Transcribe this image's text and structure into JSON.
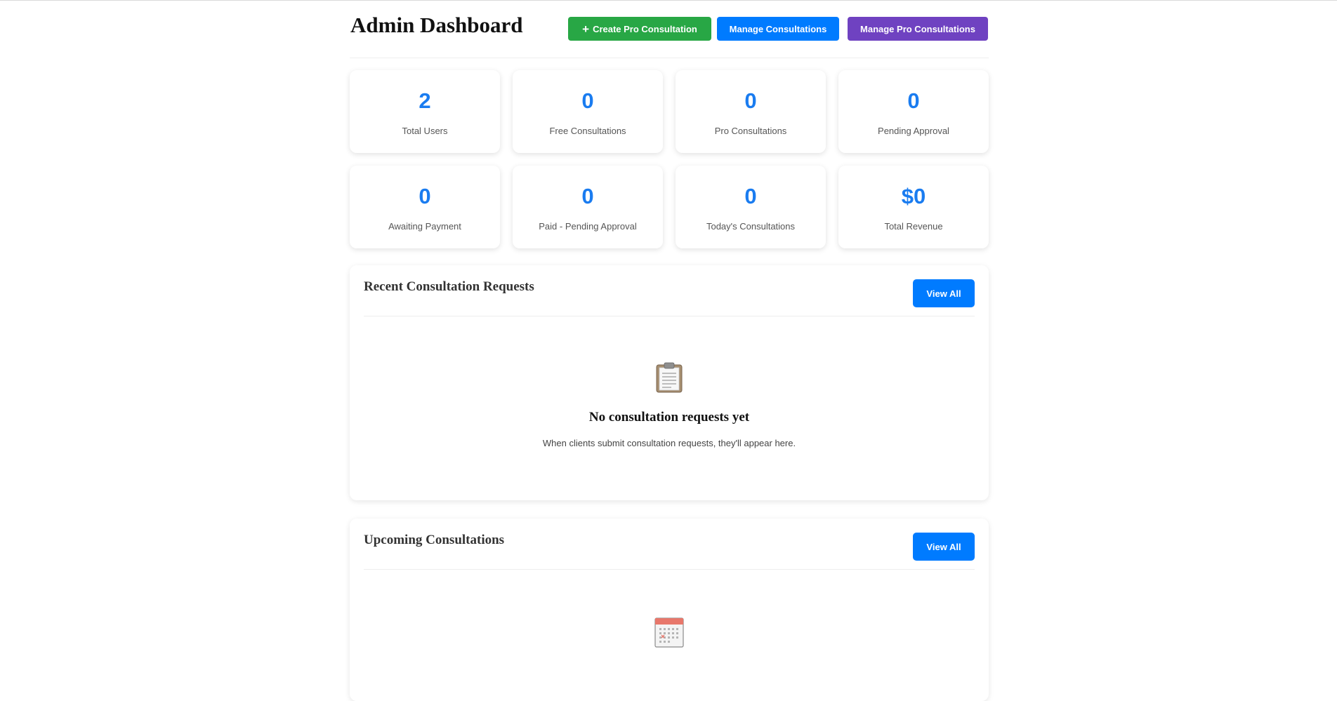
{
  "header": {
    "title": "Admin Dashboard",
    "buttons": {
      "create_pro": "Create Pro Consultation",
      "create_pro_icon": "+",
      "manage": "Manage Consultations",
      "manage_pro": "Manage Pro Consultations"
    }
  },
  "stats": [
    {
      "value": "2",
      "label": "Total Users"
    },
    {
      "value": "0",
      "label": "Free Consultations"
    },
    {
      "value": "0",
      "label": "Pro Consultations"
    },
    {
      "value": "0",
      "label": "Pending Approval"
    },
    {
      "value": "0",
      "label": "Awaiting Payment"
    },
    {
      "value": "0",
      "label": "Paid - Pending Approval"
    },
    {
      "value": "0",
      "label": "Today's Consultations"
    },
    {
      "value": "$0",
      "label": "Total Revenue"
    }
  ],
  "recent": {
    "title": "Recent Consultation Requests",
    "view_all": "View All",
    "empty_icon": "clipboard-icon",
    "empty_title": "No consultation requests yet",
    "empty_text": "When clients submit consultation requests, they'll appear here."
  },
  "upcoming": {
    "title": "Upcoming Consultations",
    "view_all": "View All",
    "empty_icon": "calendar-icon"
  },
  "colors": {
    "accent_blue": "#007bff",
    "green": "#28a745",
    "purple": "#6f42c1",
    "stat_number": "#1a7cf0"
  }
}
